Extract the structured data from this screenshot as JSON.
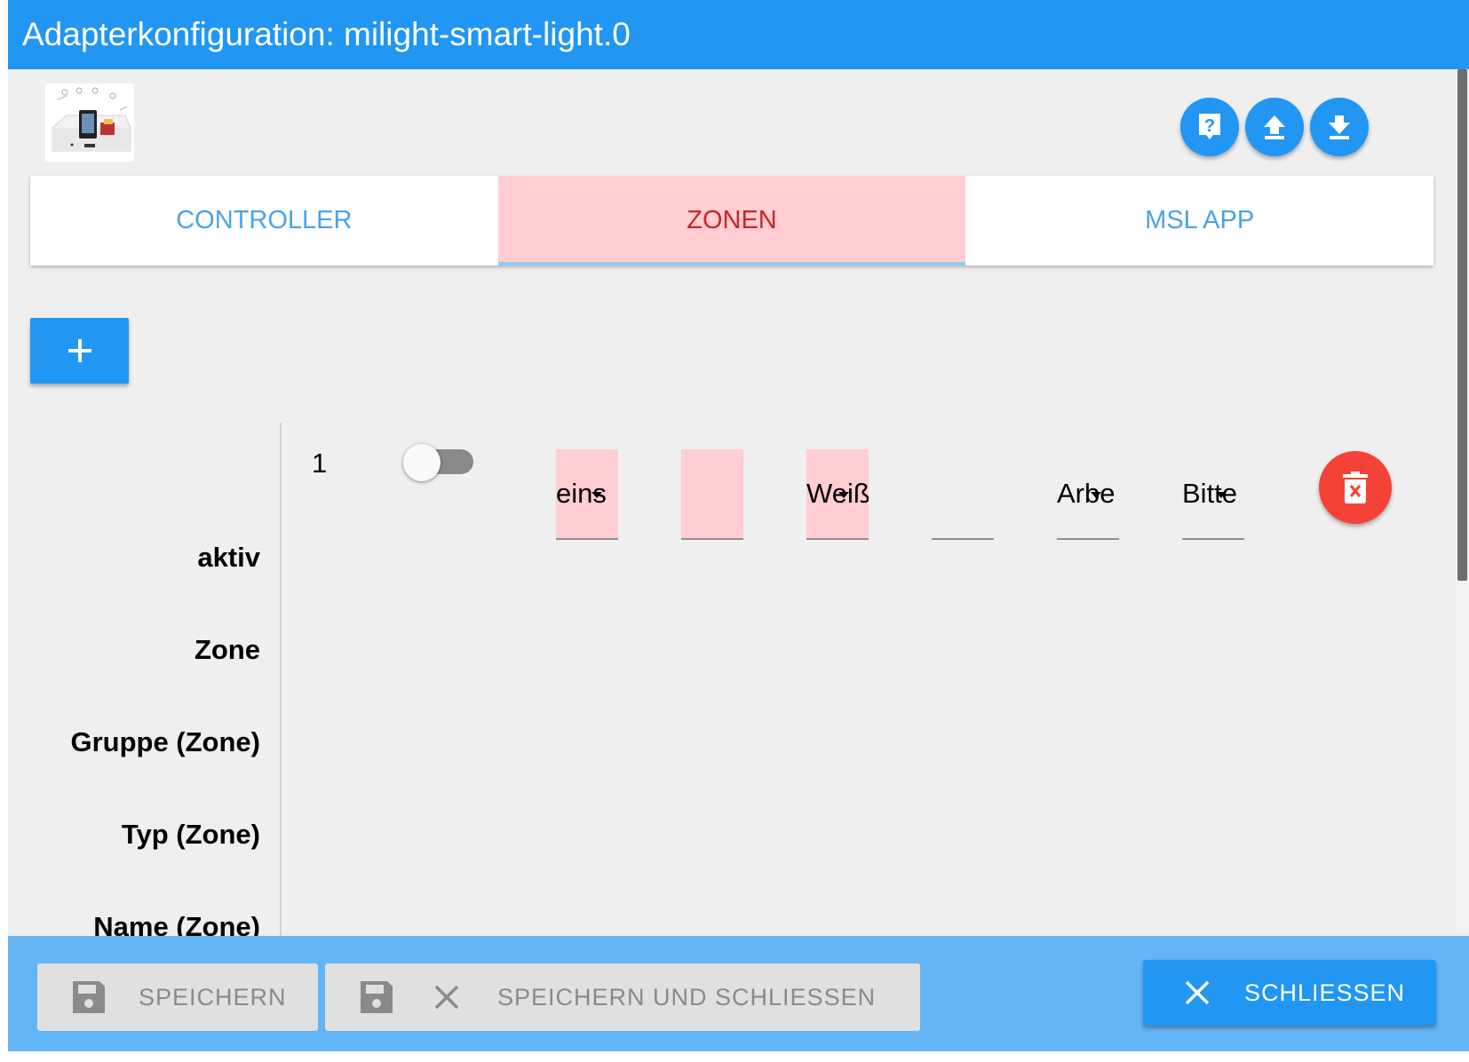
{
  "header": {
    "title": "Adapterkonfiguration: milight-smart-light.0"
  },
  "toolbar": {
    "help_icon": "help-icon",
    "upload_icon": "upload-icon",
    "download_icon": "download-icon"
  },
  "tabs": [
    {
      "label": "CONTROLLER",
      "active": false
    },
    {
      "label": "ZONEN",
      "active": true
    },
    {
      "label": "MSL APP",
      "active": false
    }
  ],
  "add_button": {
    "icon": "plus-icon"
  },
  "table": {
    "row_labels": [
      "aktiv",
      "Zone",
      "Gruppe (Zone)",
      "Typ (Zone)",
      "Name (Zone)"
    ],
    "row": {
      "index": "1",
      "active": false,
      "zone": "eins",
      "group": "",
      "type": "Weiß",
      "name": "",
      "field5": "Arbe",
      "field6": "Bitte"
    }
  },
  "footer": {
    "save": "SPEICHERN",
    "save_close": "SPEICHERN UND SCHLIESSEN",
    "close": "SCHLIESSEN"
  },
  "colors": {
    "primary": "#2196f3",
    "footer": "#64b5f6",
    "active_tab_bg": "#ffcdd2",
    "active_tab_text": "#c62828",
    "delete": "#f44336"
  }
}
